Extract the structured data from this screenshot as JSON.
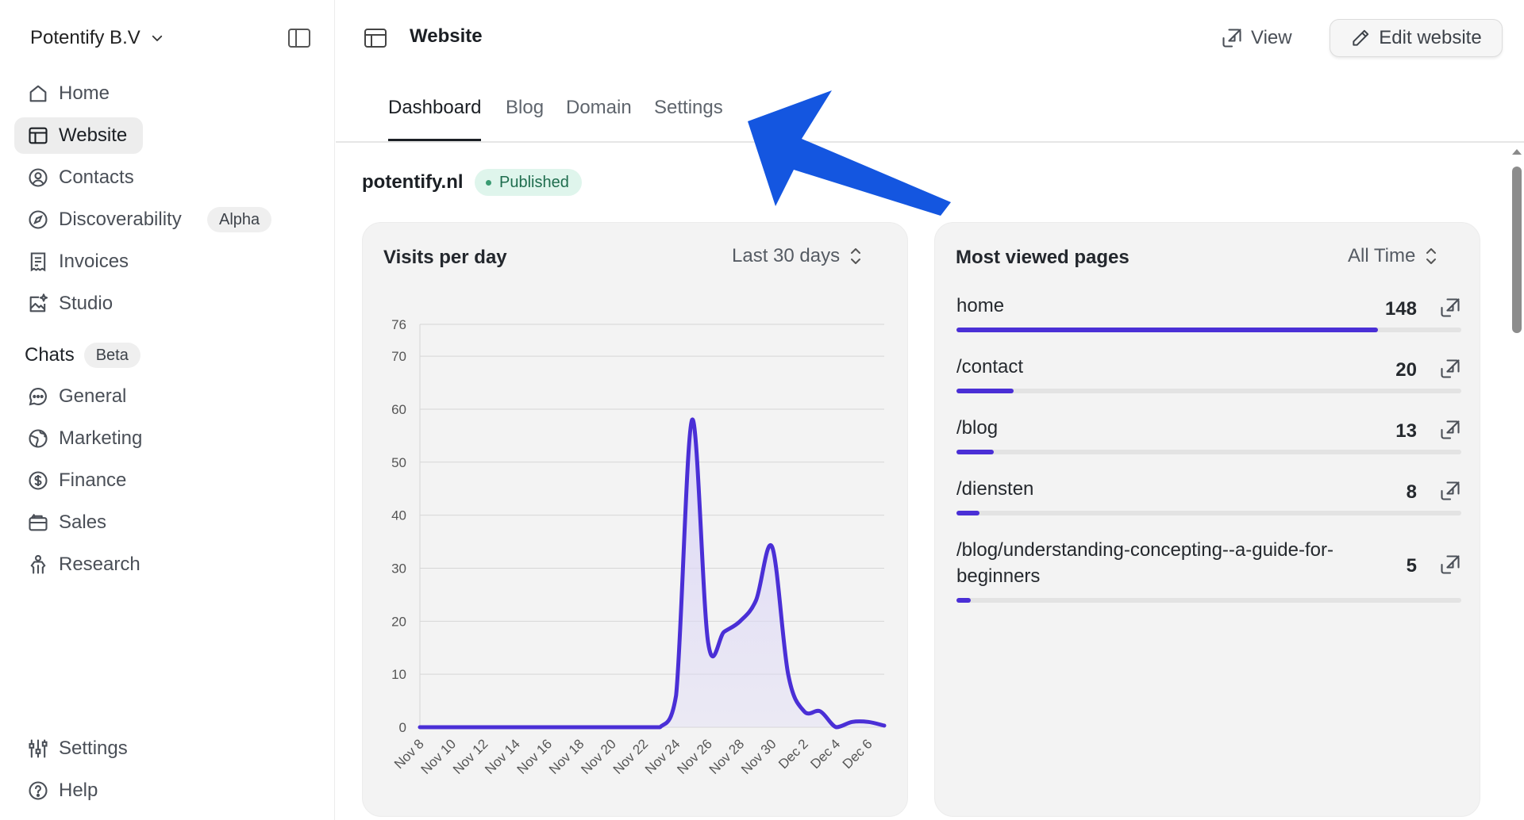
{
  "sidebar": {
    "org_name": "Potentify B.V",
    "items": [
      {
        "label": "Home",
        "icon": "home-icon",
        "active": false
      },
      {
        "label": "Website",
        "icon": "layout-icon",
        "active": true
      },
      {
        "label": "Contacts",
        "icon": "user-circle-icon",
        "active": false
      },
      {
        "label": "Discoverability",
        "icon": "compass-icon",
        "active": false,
        "badge": "Alpha"
      },
      {
        "label": "Invoices",
        "icon": "receipt-icon",
        "active": false
      },
      {
        "label": "Studio",
        "icon": "image-sparkle-icon",
        "active": false
      }
    ],
    "chats": {
      "title": "Chats",
      "badge": "Beta",
      "items": [
        {
          "label": "General",
          "icon": "chat-bubble-icon"
        },
        {
          "label": "Marketing",
          "icon": "globe-icon"
        },
        {
          "label": "Finance",
          "icon": "dollar-circle-icon"
        },
        {
          "label": "Sales",
          "icon": "briefcase-icon"
        },
        {
          "label": "Research",
          "icon": "person-icon"
        }
      ]
    },
    "footer": [
      {
        "label": "Settings",
        "icon": "sliders-icon"
      },
      {
        "label": "Help",
        "icon": "help-circle-icon"
      }
    ]
  },
  "header": {
    "title": "Website",
    "view_label": "View",
    "edit_label": "Edit website"
  },
  "tabs": [
    {
      "label": "Dashboard",
      "active": true
    },
    {
      "label": "Blog",
      "active": false
    },
    {
      "label": "Domain",
      "active": false
    },
    {
      "label": "Settings",
      "active": false
    }
  ],
  "site": {
    "domain": "potentify.nl",
    "status": "Published"
  },
  "visits_card": {
    "title": "Visits per day",
    "range": "Last 30 days"
  },
  "pages_card": {
    "title": "Most viewed pages",
    "range": "All Time",
    "max": 148,
    "pages": [
      {
        "path": "home",
        "count": 148
      },
      {
        "path": "/contact",
        "count": 20
      },
      {
        "path": "/blog",
        "count": 13
      },
      {
        "path": "/diensten",
        "count": 8
      },
      {
        "path": "/blog/understanding-concepting--a-guide-for-beginners",
        "count": 5
      }
    ]
  },
  "chart_data": {
    "type": "area",
    "title": "Visits per day",
    "xlabel": "",
    "ylabel": "",
    "ylim": [
      0,
      76
    ],
    "yticks": [
      0,
      10,
      20,
      30,
      40,
      50,
      60,
      70,
      76
    ],
    "grid": true,
    "legend": "none",
    "x_tick_labels": [
      "Nov 8",
      "Nov 10",
      "Nov 12",
      "Nov 14",
      "Nov 16",
      "Nov 18",
      "Nov 20",
      "Nov 22",
      "Nov 24",
      "Nov 26",
      "Nov 28",
      "Nov 30",
      "Dec 2",
      "Dec 4",
      "Dec 6"
    ],
    "x": [
      "Nov 8",
      "Nov 9",
      "Nov 10",
      "Nov 11",
      "Nov 12",
      "Nov 13",
      "Nov 14",
      "Nov 15",
      "Nov 16",
      "Nov 17",
      "Nov 18",
      "Nov 19",
      "Nov 20",
      "Nov 21",
      "Nov 22",
      "Nov 23",
      "Nov 24",
      "Nov 25",
      "Nov 26",
      "Nov 27",
      "Nov 28",
      "Nov 29",
      "Nov 30",
      "Dec 1",
      "Dec 2",
      "Dec 3",
      "Dec 4",
      "Dec 5",
      "Dec 6",
      "Dec 7"
    ],
    "series": [
      {
        "values": [
          0,
          0,
          0,
          0,
          0,
          0,
          0,
          0,
          0,
          0,
          0,
          0,
          0,
          0,
          0,
          0,
          6,
          58,
          16,
          18,
          20,
          24,
          34,
          10,
          3,
          3,
          0,
          1,
          1,
          0.3
        ]
      }
    ],
    "color": "#4a2fd6",
    "fill": "#ddd8f6"
  },
  "colors": {
    "accent": "#4a2fd6",
    "published_bg": "#dff5ec",
    "annotation_arrow": "#1456e0"
  }
}
